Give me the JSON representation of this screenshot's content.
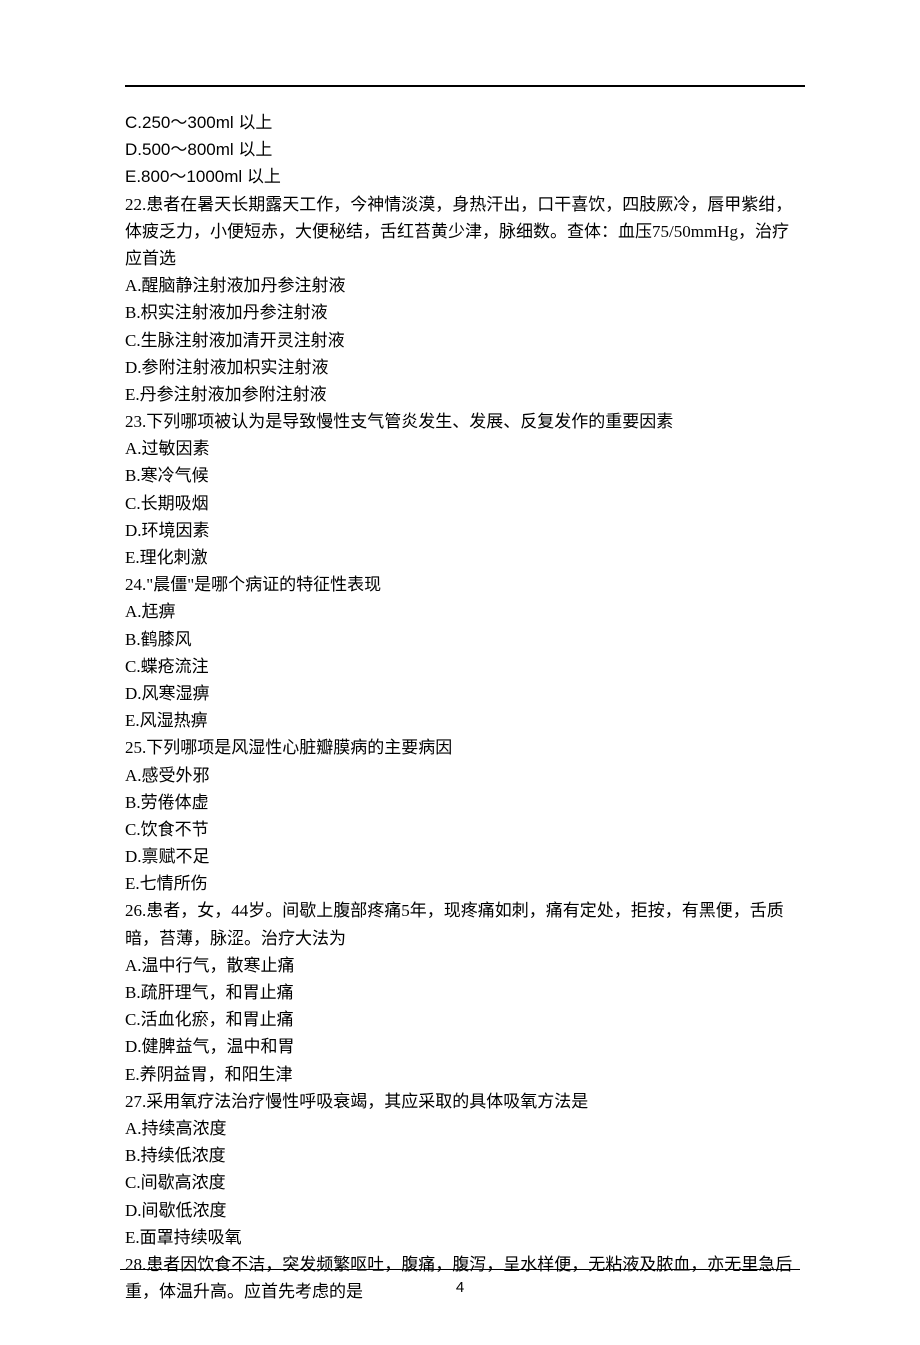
{
  "page_number": "4",
  "lines": [
    "C.250～300ml 以上",
    "D.500～800ml 以上",
    "E.800～1000ml 以上",
    "22.患者在暑天长期露天工作，今神情淡漠，身热汗出，口干喜饮，四肢厥冷，唇甲紫绀，体疲乏力，小便短赤，大便秘结，舌红苔黄少津，脉细数。查体：血压75/50mmHg，治疗应首选",
    "A.醒脑静注射液加丹参注射液",
    "B.枳实注射液加丹参注射液",
    "C.生脉注射液加清开灵注射液",
    "D.参附注射液加枳实注射液",
    "E.丹参注射液加参附注射液",
    "23.下列哪项被认为是导致慢性支气管炎发生、发展、反复发作的重要因素",
    "A.过敏因素",
    "B.寒冷气候",
    "C.长期吸烟",
    "D.环境因素",
    "E.理化刺激",
    "24.\"晨僵\"是哪个病证的特征性表现",
    "A.尪痹",
    "B.鹤膝风",
    "C.蝶疮流注",
    "D.风寒湿痹",
    "E.风湿热痹",
    "25.下列哪项是风湿性心脏瓣膜病的主要病因",
    "A.感受外邪",
    "B.劳倦体虚",
    "C.饮食不节",
    "D.禀赋不足",
    "E.七情所伤",
    "26.患者，女，44岁。间歇上腹部疼痛5年，现疼痛如刺，痛有定处，拒按，有黑便，舌质暗，苔薄，脉涩。治疗大法为",
    "A.温中行气，散寒止痛",
    "B.疏肝理气，和胃止痛",
    "C.活血化瘀，和胃止痛",
    "D.健脾益气，温中和胃",
    "E.养阴益胃，和阳生津",
    "27.采用氧疗法治疗慢性呼吸衰竭，其应采取的具体吸氧方法是",
    "A.持续高浓度",
    "B.持续低浓度",
    "C.间歇高浓度",
    "D.间歇低浓度",
    "E.面罩持续吸氧",
    "28.患者因饮食不洁，突发频繁呕吐，腹痛，腹泻，呈水样便，无粘液及脓血，亦无里急后重，体温升高。应首先考虑的是"
  ]
}
